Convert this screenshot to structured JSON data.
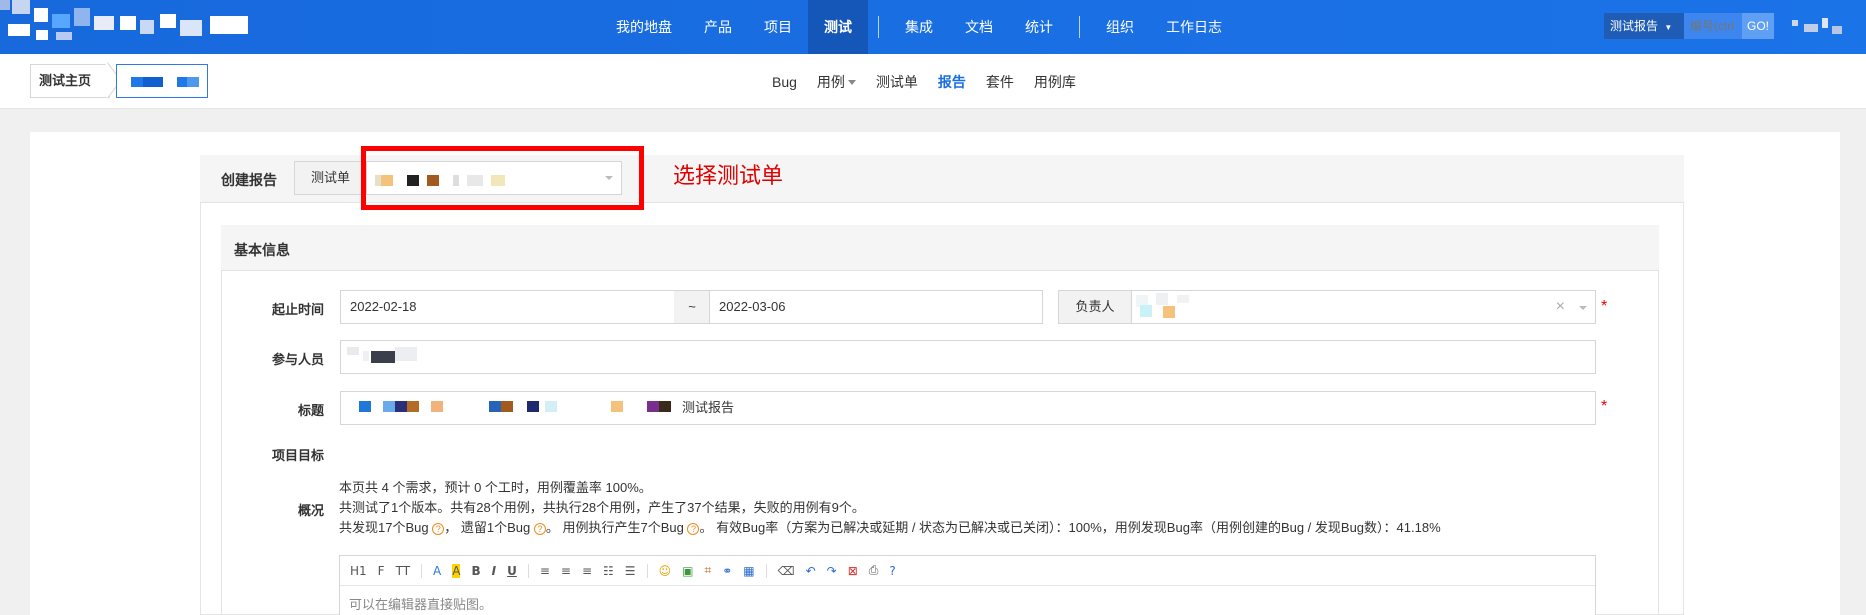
{
  "topnav": {
    "items": [
      "我的地盘",
      "产品",
      "项目",
      "测试",
      "集成",
      "文档",
      "统计",
      "组织",
      "工作日志"
    ],
    "active": "测试",
    "search_type": "测试报告",
    "search_placeholder": "编号(ctrl",
    "search_go": "GO!"
  },
  "breadcrumb": {
    "home": "测试主页"
  },
  "subnav": {
    "items": [
      "Bug",
      "用例",
      "测试单",
      "报告",
      "套件",
      "用例库"
    ],
    "active": "报告"
  },
  "create": {
    "label": "创建报告",
    "testtask_addon": "测试单",
    "annotation": "选择测试单"
  },
  "basic": {
    "title": "基本信息",
    "date_label": "起止时间",
    "start_date": "2022-02-18",
    "tilde": "~",
    "end_date": "2022-03-06",
    "owner_addon": "负责人",
    "members_label": "参与人员",
    "title_label": "标题",
    "title_suffix": "测试报告",
    "goal_label": "项目目标",
    "overview_label": "概况",
    "required_mark": "*"
  },
  "summary": {
    "line1": "本页共 4 个需求，预计 0 个工时，用例覆盖率 100%。",
    "line2": "共测试了1个版本。共有28个用例，共执行28个用例，产生了37个结果，失败的用例有9个。",
    "line3a": "共发现17个Bug",
    "line3b": "遗留1个Bug",
    "line3c": "用例执行产生7个Bug",
    "line3d": "有效Bug率（方案为已解决或延期 / 状态为已解决或已关闭）：100%，用例发现Bug率（用例创建的Bug / 发现Bug数）：41.18%"
  },
  "editor": {
    "placeholder": "可以在编辑器直接贴图。",
    "toolbar": [
      "H1",
      "F",
      "TT",
      "A",
      "A",
      "B",
      "I",
      "U",
      "≡",
      "≡",
      "≡",
      "☷",
      "☰",
      "☺",
      "▣",
      "⌗",
      "⚭",
      "▦",
      "⌫",
      "↶",
      "↷",
      "⊠",
      "⎙",
      "?"
    ]
  },
  "colors": {
    "topbar": "#1a6fe0",
    "active_nav": "#1557b8",
    "highlight": "#ff0000",
    "accent": "#1a6fe0"
  }
}
